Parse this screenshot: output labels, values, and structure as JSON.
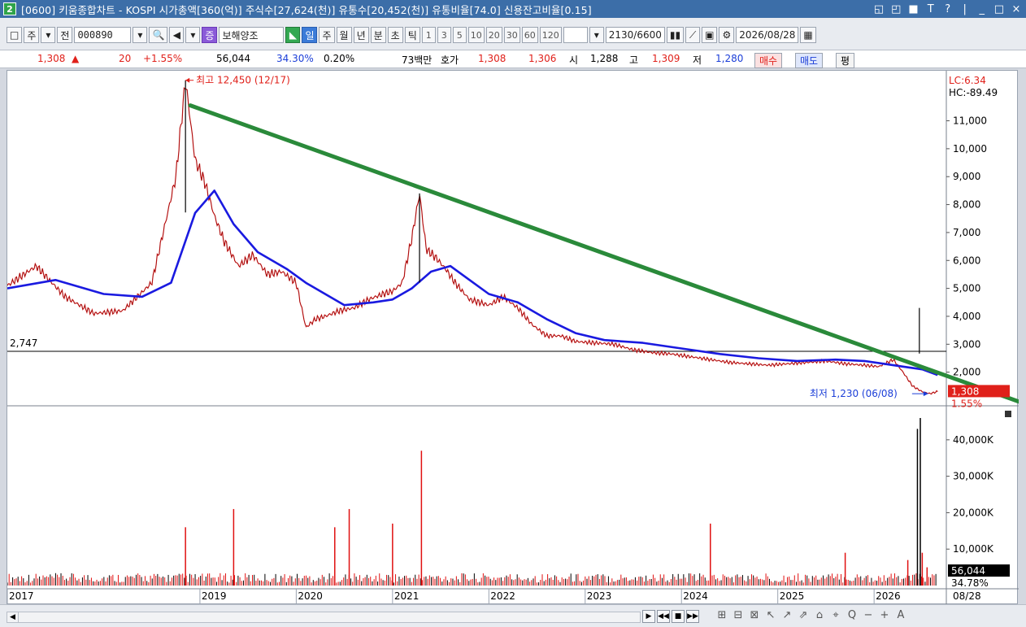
{
  "window": {
    "badge": "2",
    "title": "[0600] 키움종합차트 - KOSPI 시가총액[360(억)] 주식수[27,624(천)] 유통수[20,452(천)] 유통비율[74.0] 신용잔고비율[0.15]",
    "controls": [
      "◱",
      "◰",
      "■",
      "T",
      "?",
      "|",
      "_",
      "□",
      "×"
    ]
  },
  "toolbar": {
    "box_icon": "□",
    "market_btn": "주",
    "market_dd": "▾",
    "all_btn": "전",
    "code": "000890",
    "code_dd": "▾",
    "search_icon": "🔍",
    "sound_icon": "◀",
    "sound_dd": "▾",
    "jeung_btn": "증",
    "stock_name": "보해양조",
    "periods": [
      "일",
      "주",
      "월",
      "년",
      "분",
      "초",
      "틱"
    ],
    "active_period": "일",
    "minute_nums": [
      "1",
      "3",
      "5",
      "10",
      "20",
      "30",
      "60",
      "120"
    ],
    "count_field": "2130/6600",
    "date_field": "2026/08/28"
  },
  "quote": {
    "price": "1,308",
    "arrow": "▲",
    "change": "20",
    "change_pct": "+1.55%",
    "volume": "56,044",
    "volume_pct": "34.30%",
    "turnover": "0.20%",
    "amount": "73백만",
    "hoga_label": "호가",
    "ask": "1,308",
    "bid": "1,306",
    "open_label": "시",
    "open": "1,288",
    "high_label": "고",
    "high": "1,309",
    "low_label": "저",
    "low": "1,280",
    "buy_btn": "매수",
    "sell_btn": "매도",
    "avg_btn": "평"
  },
  "chart_data": {
    "type": "line",
    "title": "",
    "x_tick_labels": [
      "2017",
      "2019",
      "2020",
      "2021",
      "2022",
      "2023",
      "2024",
      "2025",
      "2026",
      "08/28"
    ],
    "x_ticks_year": [
      2017,
      2019,
      2020,
      2021,
      2022,
      2023,
      2024,
      2025,
      2026
    ],
    "price_axis": {
      "ylim": [
        1000,
        12500
      ],
      "ticks": [
        2000,
        3000,
        4000,
        5000,
        6000,
        7000,
        8000,
        9000,
        10000,
        11000
      ],
      "tick_labels": [
        "2,000",
        "3,000",
        "4,000",
        "5,000",
        "6,000",
        "7,000",
        "8,000",
        "9,000",
        "10,000",
        "11,000"
      ]
    },
    "volume_axis": {
      "ylim": [
        0,
        48000
      ],
      "ticks": [
        10000,
        20000,
        30000,
        40000
      ],
      "tick_labels": [
        "10,000K",
        "20,000K",
        "30,000K",
        "40,000K"
      ]
    },
    "price_series": {
      "name": "",
      "x": [
        2017.0,
        2017.3,
        2017.6,
        2017.9,
        2018.2,
        2018.5,
        2018.75,
        2018.85,
        2018.95,
        2019.05,
        2019.15,
        2019.25,
        2019.4,
        2019.55,
        2019.7,
        2019.85,
        2020.0,
        2020.1,
        2020.2,
        2020.3,
        2020.45,
        2020.6,
        2020.75,
        2020.9,
        2021.0,
        2021.1,
        2021.2,
        2021.28,
        2021.35,
        2021.45,
        2021.55,
        2021.65,
        2021.8,
        2022.0,
        2022.15,
        2022.3,
        2022.45,
        2022.6,
        2022.75,
        2022.9,
        2023.1,
        2023.3,
        2023.5,
        2023.7,
        2023.9,
        2024.1,
        2024.3,
        2024.5,
        2024.7,
        2024.9,
        2025.1,
        2025.3,
        2025.5,
        2025.7,
        2025.9,
        2026.05,
        2026.2,
        2026.3,
        2026.4,
        2026.5,
        2026.58,
        2026.66
      ],
      "y": [
        5100,
        5800,
        4700,
        4100,
        4200,
        5200,
        9000,
        12450,
        9600,
        8800,
        7600,
        6700,
        5800,
        6200,
        5500,
        5600,
        5200,
        3600,
        3900,
        4000,
        4200,
        4300,
        4600,
        4800,
        4900,
        5200,
        6800,
        8400,
        6400,
        6100,
        5700,
        5200,
        4600,
        4400,
        4700,
        4300,
        3700,
        3300,
        3300,
        3100,
        3050,
        3000,
        2800,
        2700,
        2650,
        2550,
        2450,
        2350,
        2300,
        2250,
        2300,
        2350,
        2400,
        2300,
        2250,
        2200,
        2450,
        2000,
        1500,
        1300,
        1230,
        1308
      ]
    },
    "ma_series": {
      "name": "",
      "x": [
        2017.0,
        2017.5,
        2018.0,
        2018.4,
        2018.7,
        2018.95,
        2019.15,
        2019.35,
        2019.6,
        2019.9,
        2020.1,
        2020.3,
        2020.5,
        2020.8,
        2021.0,
        2021.2,
        2021.4,
        2021.6,
        2021.8,
        2022.0,
        2022.3,
        2022.6,
        2022.9,
        2023.2,
        2023.6,
        2024.0,
        2024.4,
        2024.8,
        2025.2,
        2025.6,
        2025.9,
        2026.1,
        2026.3,
        2026.5,
        2026.66
      ],
      "y": [
        5000,
        5300,
        4800,
        4700,
        5200,
        7700,
        8500,
        7300,
        6300,
        5700,
        5200,
        4800,
        4400,
        4500,
        4600,
        5000,
        5600,
        5800,
        5300,
        4800,
        4500,
        3900,
        3400,
        3150,
        3050,
        2850,
        2650,
        2500,
        2400,
        2450,
        2400,
        2300,
        2200,
        2100,
        1900
      ]
    },
    "volume_spikes": [
      {
        "x": 2018.85,
        "v": 16000
      },
      {
        "x": 2019.35,
        "v": 21000
      },
      {
        "x": 2020.4,
        "v": 16000
      },
      {
        "x": 2020.55,
        "v": 21000
      },
      {
        "x": 2021.3,
        "v": 37000
      },
      {
        "x": 2021.0,
        "v": 17000
      },
      {
        "x": 2024.3,
        "v": 17000
      },
      {
        "x": 2025.7,
        "v": 9000
      },
      {
        "x": 2026.35,
        "v": 7000
      },
      {
        "x": 2026.45,
        "v": 43000
      },
      {
        "x": 2026.48,
        "v": 46000
      },
      {
        "x": 2026.5,
        "v": 9000
      },
      {
        "x": 2026.55,
        "v": 5000
      }
    ],
    "reference_line": {
      "value": 2747,
      "label": "2,747"
    },
    "trendline": {
      "x": [
        2018.9,
        2029.0
      ],
      "y": [
        11550,
        -900
      ]
    },
    "annotations": {
      "high": {
        "label": "최고 12,450 (12/17)",
        "value": 12450
      },
      "low": {
        "label": "최저 1,230 (06/08)",
        "value": 1230
      },
      "lc": "LC:6.34",
      "hc": "HC:-89.49"
    },
    "last_price_label": "1,308",
    "last_price_pct": "1.55%",
    "last_volume_label": "56,044",
    "last_volume_pct": "34.78%",
    "colors": {
      "price": "#d81818",
      "ma": "#1a1ae0",
      "trend": "#2a8a3a",
      "volume": "#e01010"
    }
  },
  "bottom": {
    "nav_buttons": [
      "▶",
      "◀◀",
      "■",
      "▶▶"
    ],
    "tool_icons": [
      "⊞",
      "⊟",
      "⊠",
      "↖",
      "↗",
      "⇗",
      "⌂",
      "⌖",
      "Q",
      "−",
      "+",
      "A"
    ]
  }
}
